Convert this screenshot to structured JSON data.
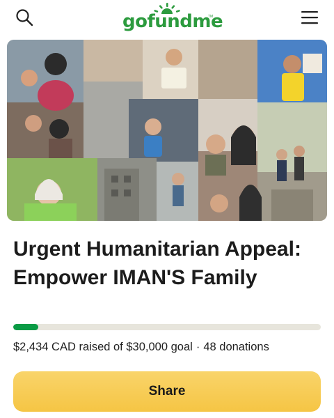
{
  "header": {
    "logo_text": "gofundme",
    "logo_tm": "TM",
    "search_icon": "search-icon",
    "menu_icon": "hamburger-menu-icon"
  },
  "colors": {
    "brand_green": "#2c9b3e",
    "progress_green": "#0a9b45",
    "share_yellow": "#f5c544"
  },
  "campaign": {
    "title": "Urgent Humanitarian Appeal: Empower IMAN'S Family",
    "raised_amount": "$2,434 CAD",
    "raised_text": "raised of",
    "goal_amount": "$30,000",
    "goal_text": "goal",
    "separator": "·",
    "donations": "48 donations",
    "progress_fraction": 0.081
  },
  "actions": {
    "share_label": "Share"
  }
}
